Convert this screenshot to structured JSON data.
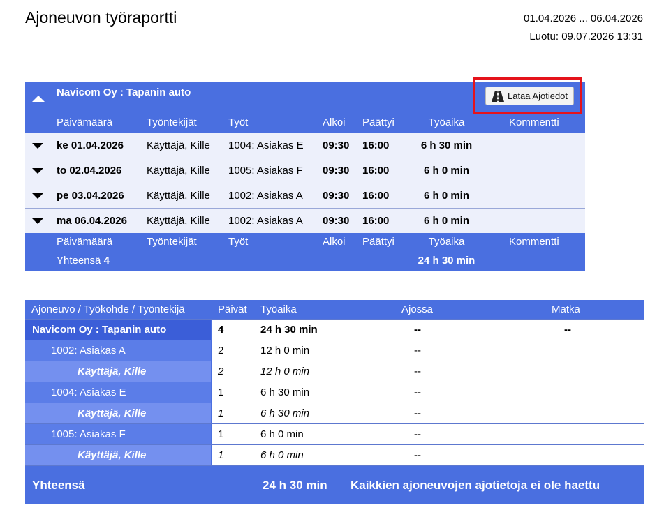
{
  "page": {
    "title": "Ajoneuvon työraportti",
    "date_range": "01.04.2026 ... 06.04.2026",
    "created": "Luotu: 09.07.2026 13:31"
  },
  "report": {
    "company": "Navicom Oy : Tapanin auto",
    "download_button": "Lataa Ajotiedot",
    "columns": {
      "date": "Päivämäärä",
      "employees": "Työntekijät",
      "jobs": "Työt",
      "start": "Alkoi",
      "end": "Päättyi",
      "worktime": "Työaika",
      "comment": "Kommentti"
    },
    "rows": [
      {
        "date": "ke 01.04.2026",
        "employee": "Käyttäjä, Kille",
        "job": "1004: Asiakas E",
        "start": "09:30",
        "end": "16:00",
        "worktime": "6 h 30 min",
        "comment": ""
      },
      {
        "date": "to 02.04.2026",
        "employee": "Käyttäjä, Kille",
        "job": "1005: Asiakas F",
        "start": "09:30",
        "end": "16:00",
        "worktime": "6 h 0 min",
        "comment": ""
      },
      {
        "date": "pe 03.04.2026",
        "employee": "Käyttäjä, Kille",
        "job": "1002: Asiakas A",
        "start": "09:30",
        "end": "16:00",
        "worktime": "6 h 0 min",
        "comment": ""
      },
      {
        "date": "ma 06.04.2026",
        "employee": "Käyttäjä, Kille",
        "job": "1002: Asiakas A",
        "start": "09:30",
        "end": "16:00",
        "worktime": "6 h 0 min",
        "comment": ""
      }
    ],
    "total_label": "Yhteensä",
    "total_count": "4",
    "total_worktime": "24 h 30 min"
  },
  "summary": {
    "columns": {
      "name": "Ajoneuvo / Työkohde / Työntekijä",
      "days": "Päivät",
      "worktime": "Työaika",
      "driving": "Ajossa",
      "trip": "Matka"
    },
    "rows": [
      {
        "name": "Navicom Oy : Tapanin auto",
        "days": "4",
        "worktime": "24 h 30 min",
        "driving": "--",
        "trip": "--"
      },
      {
        "name": "1002: Asiakas A",
        "days": "2",
        "worktime": "12 h 0 min",
        "driving": "--",
        "trip": ""
      },
      {
        "name": "Käyttäjä, Kille",
        "days": "2",
        "worktime": "12 h 0 min",
        "driving": "--",
        "trip": ""
      },
      {
        "name": "1004: Asiakas E",
        "days": "1",
        "worktime": "6 h 30 min",
        "driving": "--",
        "trip": ""
      },
      {
        "name": "Käyttäjä, Kille",
        "days": "1",
        "worktime": "6 h 30 min",
        "driving": "--",
        "trip": ""
      },
      {
        "name": "1005: Asiakas F",
        "days": "1",
        "worktime": "6 h 0 min",
        "driving": "--",
        "trip": ""
      },
      {
        "name": "Käyttäjä, Kille",
        "days": "1",
        "worktime": "6 h 0 min",
        "driving": "--",
        "trip": ""
      }
    ],
    "total_label": "Yhteensä",
    "total_worktime": "24 h 30 min",
    "total_note": "Kaikkien ajoneuvojen ajotietoja ei ole haettu"
  }
}
